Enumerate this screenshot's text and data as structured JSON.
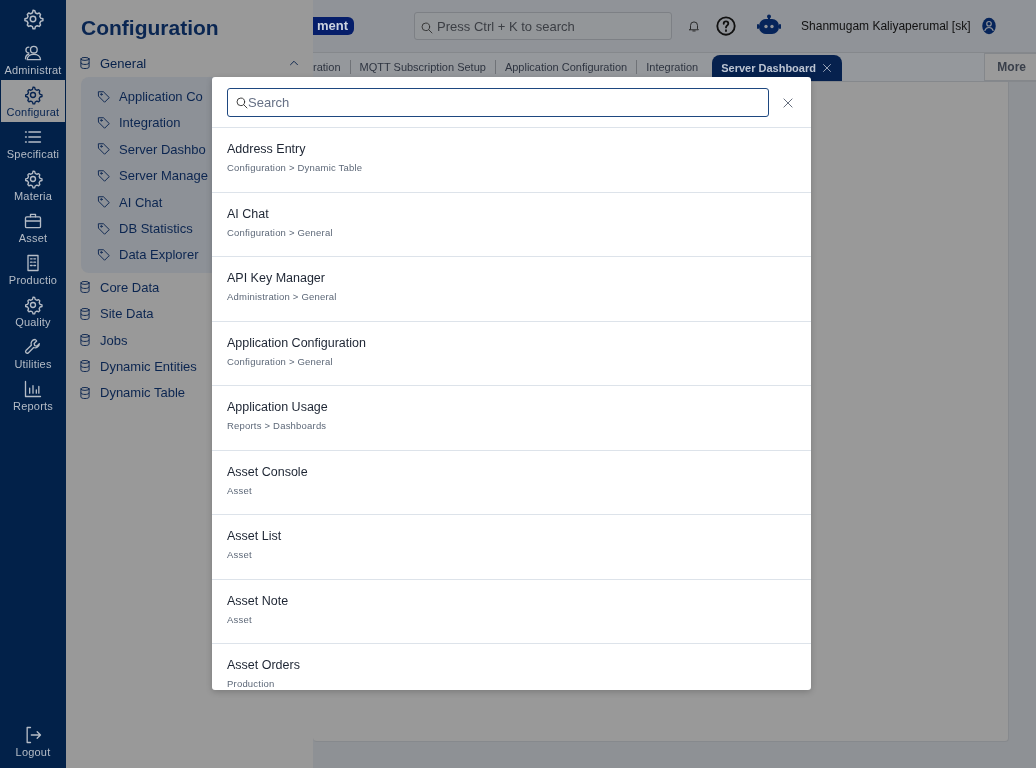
{
  "rail": {
    "items": [
      {
        "label": "Administrat",
        "selected": false
      },
      {
        "label": "Configurat",
        "selected": true
      },
      {
        "label": "Specificati",
        "selected": false
      },
      {
        "label": "Materia",
        "selected": false
      },
      {
        "label": "Asset",
        "selected": false
      },
      {
        "label": "Productio",
        "selected": false
      },
      {
        "label": "Quality",
        "selected": false
      },
      {
        "label": "Utilities",
        "selected": false
      },
      {
        "label": "Reports",
        "selected": false
      }
    ],
    "logout": "Logout"
  },
  "panel": {
    "title": "Configuration",
    "tree": [
      {
        "label": "General",
        "expanded": true,
        "children": [
          {
            "label": "Application Co"
          },
          {
            "label": "Integration"
          },
          {
            "label": "Server Dashbo"
          },
          {
            "label": "Server Manage"
          },
          {
            "label": "AI Chat"
          },
          {
            "label": "DB Statistics"
          },
          {
            "label": "Data Explorer"
          }
        ]
      },
      {
        "label": "Core Data"
      },
      {
        "label": "Site Data"
      },
      {
        "label": "Jobs"
      },
      {
        "label": "Dynamic Entities"
      },
      {
        "label": "Dynamic Table"
      }
    ]
  },
  "header": {
    "badge": "ment",
    "search": {
      "placeholder": "Press Ctrl + K to search"
    },
    "user": "Shanmugam Kaliyaperumal [sk]"
  },
  "tabs": [
    {
      "label": "ration",
      "selected": false
    },
    {
      "label": "MQTT Subscription Setup",
      "selected": false
    },
    {
      "label": "Application Configuration",
      "selected": false
    },
    {
      "label": "Integration",
      "selected": false
    },
    {
      "label": "Server Dashboard",
      "selected": true
    }
  ],
  "more": "More",
  "dialog": {
    "search": {
      "placeholder": "Search"
    },
    "results": [
      {
        "title": "Address Entry",
        "path": "Configuration > Dynamic Table"
      },
      {
        "title": "AI Chat",
        "path": "Configuration > General"
      },
      {
        "title": "API Key Manager",
        "path": "Administration > General"
      },
      {
        "title": "Application Configuration",
        "path": "Configuration > General"
      },
      {
        "title": "Application Usage",
        "path": "Reports > Dashboards"
      },
      {
        "title": "Asset Console",
        "path": "Asset"
      },
      {
        "title": "Asset List",
        "path": "Asset"
      },
      {
        "title": "Asset Note",
        "path": "Asset"
      },
      {
        "title": "Asset Orders",
        "path": "Production"
      }
    ]
  }
}
